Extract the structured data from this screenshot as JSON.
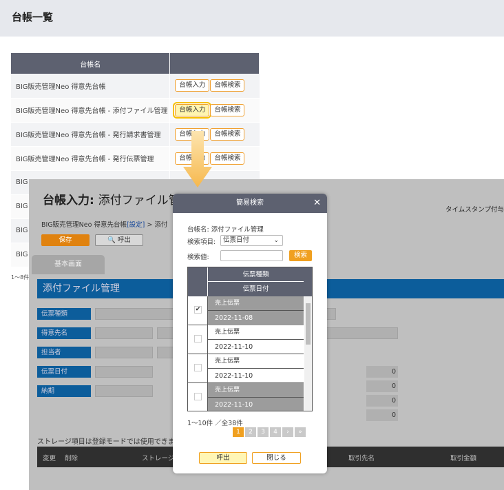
{
  "page": {
    "title": "台帳一覧"
  },
  "ledger": {
    "header": "台帳名",
    "input_label": "台帳入力",
    "search_label": "台帳検索",
    "rows": [
      "BIG販売管理Neo 得意先台帳",
      "BIG販売管理Neo 得意先台帳 - 添付ファイル管理",
      "BIG販売管理Neo 得意先台帳 - 発行請求書管理",
      "BIG販売管理Neo 得意先台帳 - 発行伝票管理",
      "BIG",
      "BIG",
      "BIG",
      "BIG"
    ],
    "count": "1～8件"
  },
  "form": {
    "title_prefix": "台帳入力:",
    "title_name": "添付ファイル管理",
    "breadcrumb_main": "BIG販売管理Neo 得意先台帳",
    "breadcrumb_link": "[設定]",
    "breadcrumb_tail": " > 添付",
    "timestamp": "タイムスタンプ付与",
    "save": "保存",
    "call": "呼出",
    "tab": "基本画面",
    "section": "添付ファイル管理",
    "fields": [
      "伝票種類",
      "得意先名",
      "担当者",
      "伝票日付",
      "納期"
    ],
    "zeros": [
      "0",
      "0",
      "0",
      "0"
    ],
    "note": "ストレージ項目は登録モードでは使用できま",
    "table_headers": {
      "change": "変更",
      "delete": "削除",
      "storage": "ストレージ",
      "client": "取引先名",
      "amount": "取引金額"
    }
  },
  "modal": {
    "title": "簡易検索",
    "ledger_name": "台帳名: 添付ファイル管理",
    "field_label": "検索項目:",
    "field_value": "伝票日付",
    "value_label": "検索値:",
    "search_button": "検索",
    "col1": "伝票種類",
    "col2": "伝票日付",
    "records": [
      {
        "type": "売上伝票",
        "date": "2022-11-08",
        "checked": "✔"
      },
      {
        "type": "売上伝票",
        "date": "2022-11-10",
        "checked": ""
      },
      {
        "type": "売上伝票",
        "date": "2022-11-10",
        "checked": ""
      },
      {
        "type": "売上伝票",
        "date": "2022-11-10",
        "checked": ""
      }
    ],
    "count": "1～10件 ／全38件",
    "pages": [
      "1",
      "2",
      "3",
      "4",
      "›",
      "»"
    ],
    "call_button": "呼出",
    "close_button": "閉じる"
  }
}
